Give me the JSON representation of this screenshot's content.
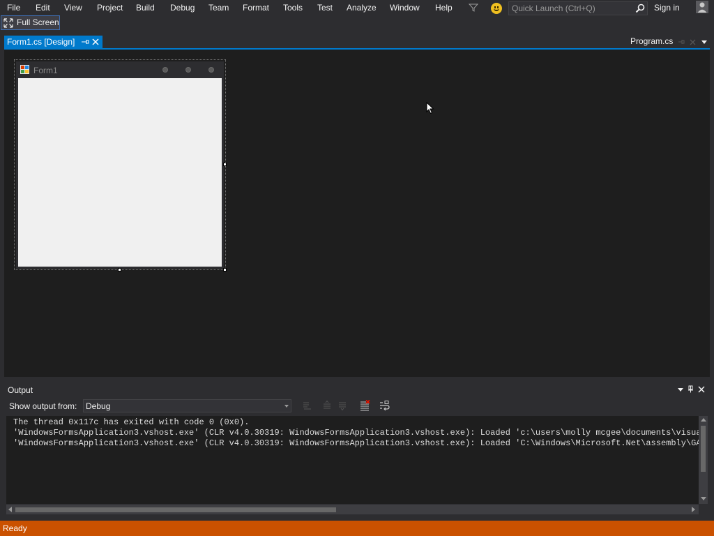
{
  "menu": {
    "items": [
      "File",
      "Edit",
      "View",
      "Project",
      "Build",
      "Debug",
      "Team",
      "Format",
      "Tools",
      "Test",
      "Analyze",
      "Window",
      "Help"
    ]
  },
  "quick_launch": {
    "placeholder": "Quick Launch (Ctrl+Q)"
  },
  "account": {
    "sign_in_label": "Sign in"
  },
  "toolbar": {
    "fullscreen_label": "Full Screen"
  },
  "tabs": {
    "active": {
      "label": "Form1.cs [Design]"
    },
    "secondary": {
      "label": "Program.cs"
    }
  },
  "designer": {
    "form_title": "Form1"
  },
  "output": {
    "title": "Output",
    "show_output_from_label": "Show output from:",
    "source": "Debug",
    "lines": [
      "The thread 0x117c has exited with code 0 (0x0).",
      "'WindowsFormsApplication3.vshost.exe' (CLR v4.0.30319: WindowsFormsApplication3.vshost.exe): Loaded 'c:\\users\\molly mcgee\\documents\\visual studio",
      "'WindowsFormsApplication3.vshost.exe' (CLR v4.0.30319: WindowsFormsApplication3.vshost.exe): Loaded 'C:\\Windows\\Microsoft.Net\\assembly\\GAC_MSIL"
    ]
  },
  "status": {
    "text": "Ready"
  },
  "colors": {
    "accent": "#007acc",
    "status_bar": "#ca5100",
    "chrome": "#2d2d30",
    "editor": "#1e1e1e"
  },
  "icons": {
    "filter": "filter-icon",
    "feedback": "smiley-icon",
    "search": "search-icon",
    "account": "account-icon",
    "fullscreen": "fullscreen-icon"
  }
}
